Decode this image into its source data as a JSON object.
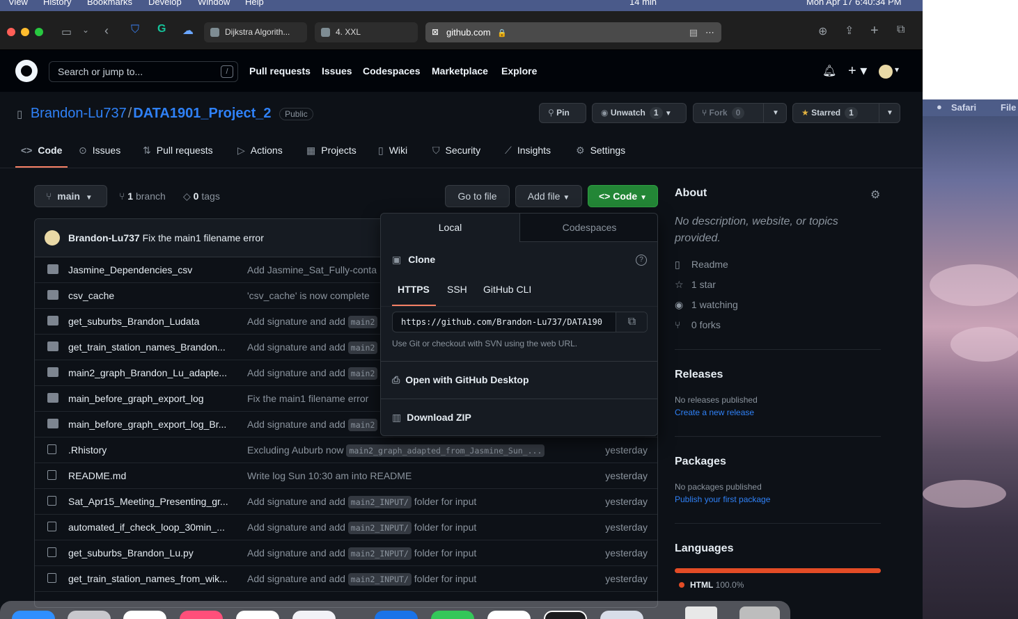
{
  "menubar": {
    "items": [
      "View",
      "History",
      "Bookmarks",
      "Develop",
      "Window",
      "Help"
    ],
    "status_time": "14 min",
    "datetime": "Mon Apr 17  6:40:34 PM"
  },
  "safari": {
    "tabs": [
      {
        "label": "Dijkstra Algorith..."
      },
      {
        "label": "4. XXL"
      }
    ],
    "address": "github.com"
  },
  "github": {
    "search_placeholder": "Search or jump to...",
    "search_shortcut": "/",
    "nav": [
      "Pull requests",
      "Issues",
      "Codespaces",
      "Marketplace",
      "Explore"
    ]
  },
  "repo": {
    "owner": "Brandon-Lu737",
    "separator": "/",
    "name": "DATA1901_Project_2",
    "visibility": "Public",
    "pin_label": "Pin",
    "unwatch_label": "Unwatch",
    "watch_count": "1",
    "fork_label": "Fork",
    "fork_count": "0",
    "starred_label": "Starred",
    "star_count": "1",
    "tabs": [
      "Code",
      "Issues",
      "Pull requests",
      "Actions",
      "Projects",
      "Wiki",
      "Security",
      "Insights",
      "Settings"
    ]
  },
  "toolbar": {
    "branch": "main",
    "branch_count": "1",
    "branch_word": "branch",
    "tag_count": "0",
    "tag_word": "tags",
    "go_to_file": "Go to file",
    "add_file": "Add file",
    "code": "Code"
  },
  "latest_commit": {
    "author": "Brandon-Lu737",
    "message": "Fix the main1 filename error"
  },
  "files": [
    {
      "type": "dir",
      "name": "Jasmine_Dependencies_csv",
      "msg": "Add Jasmine_Sat_Fully-conta",
      "tag": "",
      "after": "",
      "when": ""
    },
    {
      "type": "dir",
      "name": "csv_cache",
      "msg": "'csv_cache' is now complete",
      "tag": "",
      "after": "",
      "when": ""
    },
    {
      "type": "dir",
      "name": "get_suburbs_Brandon_Ludata",
      "msg": "Add signature and add",
      "tag": "main2",
      "after": "",
      "when": ""
    },
    {
      "type": "dir",
      "name": "get_train_station_names_Brandon...",
      "msg": "Add signature and add",
      "tag": "main2",
      "after": "",
      "when": ""
    },
    {
      "type": "dir",
      "name": "main2_graph_Brandon_Lu_adapte...",
      "msg": "Add signature and add",
      "tag": "main2",
      "after": "",
      "when": ""
    },
    {
      "type": "dir",
      "name": "main_before_graph_export_log",
      "msg": "Fix the main1 filename error",
      "tag": "",
      "after": "",
      "when": ""
    },
    {
      "type": "dir",
      "name": "main_before_graph_export_log_Br...",
      "msg": "Add signature and add",
      "tag": "main2",
      "after": "",
      "when": ""
    },
    {
      "type": "file",
      "name": ".Rhistory",
      "msg": "Excluding Auburb now",
      "tag": "main2_graph_adapted_from_Jasmine_Sun_...",
      "after": "",
      "when": "yesterday"
    },
    {
      "type": "file",
      "name": "README.md",
      "msg": "Write log Sun 10:30 am into README",
      "tag": "",
      "after": "",
      "when": "yesterday"
    },
    {
      "type": "file",
      "name": "Sat_Apr15_Meeting_Presenting_gr...",
      "msg": "Add signature and add",
      "tag": "main2_INPUT/",
      "after": "folder for input",
      "when": "yesterday"
    },
    {
      "type": "file",
      "name": "automated_if_check_loop_30min_...",
      "msg": "Add signature and add",
      "tag": "main2_INPUT/",
      "after": "folder for input",
      "when": "yesterday"
    },
    {
      "type": "file",
      "name": "get_suburbs_Brandon_Lu.py",
      "msg": "Add signature and add",
      "tag": "main2_INPUT/",
      "after": "folder for input",
      "when": "yesterday"
    },
    {
      "type": "file",
      "name": "get_train_station_names_from_wik...",
      "msg": "Add signature and add",
      "tag": "main2_INPUT/",
      "after": "folder for input",
      "when": "yesterday"
    }
  ],
  "code_dropdown": {
    "tab_local": "Local",
    "tab_codespaces": "Codespaces",
    "clone_label": "Clone",
    "proto_https": "HTTPS",
    "proto_ssh": "SSH",
    "proto_cli": "GitHub CLI",
    "url": "https://github.com/Brandon-Lu737/DATA190",
    "hint": "Use Git or checkout with SVN using the web URL.",
    "open_desktop": "Open with GitHub Desktop",
    "download_zip": "Download ZIP"
  },
  "about": {
    "title": "About",
    "description": "No description, website, or topics provided.",
    "readme": "Readme",
    "stars": "1 star",
    "watching": "1 watching",
    "forks": "0 forks"
  },
  "releases": {
    "title": "Releases",
    "none": "No releases published",
    "create": "Create a new release"
  },
  "packages": {
    "title": "Packages",
    "none": "No packages published",
    "publish": "Publish your first package"
  },
  "languages": {
    "title": "Languages",
    "items": [
      {
        "name": "HTML",
        "percent": "100.0%",
        "color": "#e34c26"
      }
    ]
  },
  "desktop": {
    "menu_app": "Safari",
    "menu_file": "File"
  },
  "colors": {
    "accent_green": "#238636",
    "link_blue": "#2f81f7",
    "active_tab_underline": "#f78166",
    "html_lang": "#e34c26"
  }
}
